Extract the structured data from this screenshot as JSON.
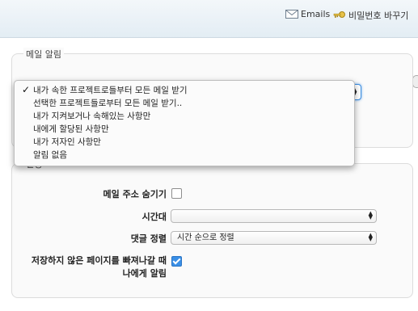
{
  "header": {
    "emails_label": "Emails",
    "password_label": "비밀번호 바꾸기"
  },
  "mail_notification": {
    "legend": "메일 알림",
    "options": [
      "내가 속한 프로젝트로들부터 모든 메일 받기",
      "선택한 프로젝트들로부터 모든 메일 받기..",
      "내가 지켜보거나 속해있는 사항만",
      "내에게 할당된 사항만",
      "내가 저자인 사항만",
      "알림 없음"
    ],
    "selected_mark": "✓"
  },
  "preferences": {
    "legend": "설정",
    "hide_email_label": "메일 주소 숨기기",
    "hide_email_checked": false,
    "timezone_label": "시간대",
    "timezone_value": "",
    "comment_order_label": "댓글 정렬",
    "comment_order_value": "시간 순으로 정렬",
    "warn_leave_label_line1": "저장하지 않은 페이지를 빠져나갈 때",
    "warn_leave_label_line2": "나에게 알림",
    "warn_leave_checked": true
  },
  "colors": {
    "header_bg": "#e3edf4",
    "checkbox_checked": "#3a8fe6",
    "select_focus": "#3b8de0"
  }
}
